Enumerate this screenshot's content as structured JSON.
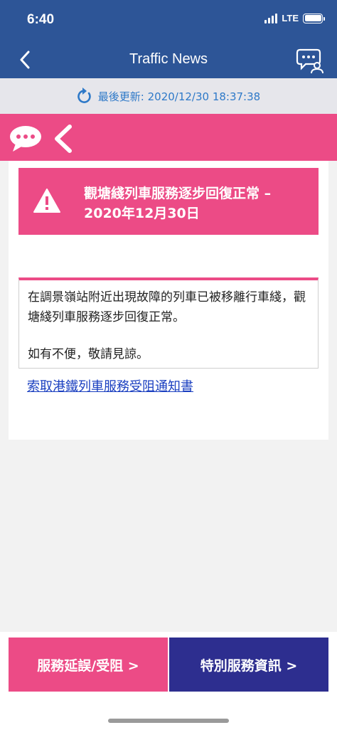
{
  "status_bar": {
    "time": "6:40",
    "network": "LTE"
  },
  "nav": {
    "title": "Traffic News"
  },
  "update": {
    "text": "最後更新: 2020/12/30 18:37:38"
  },
  "alert": {
    "title": "觀塘綫列車服務逐步回復正常 – 2020年12月30日"
  },
  "message": {
    "paragraph1": "在調景嶺站附近出現故障的列車已被移離行車綫，觀塘綫列車服務逐步回復正常。",
    "paragraph2": "如有不便，敬請見諒。"
  },
  "link": {
    "text": "索取港鐵列車服務受阻通知書"
  },
  "buttons": {
    "delay": "服務延誤/受阻 >",
    "special": "特別服務資訊 >"
  },
  "colors": {
    "header": "#2d5597",
    "accent": "#ec4b86",
    "special": "#2d2e8f",
    "link": "#1a3fc0"
  }
}
